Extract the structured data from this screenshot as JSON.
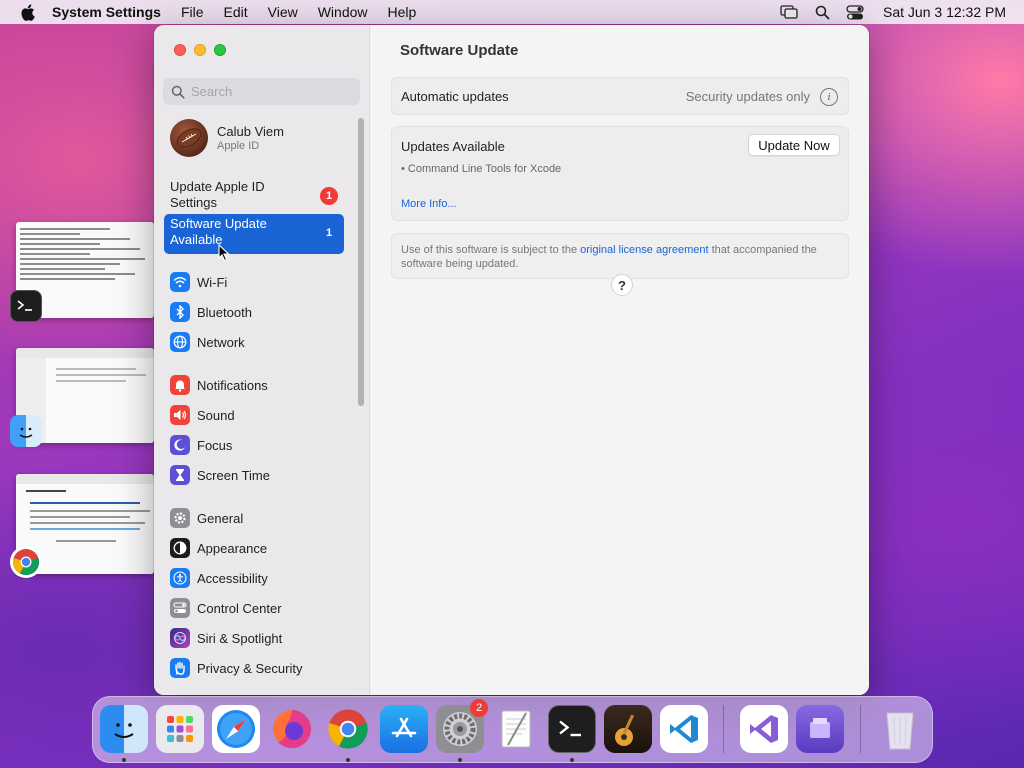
{
  "menubar": {
    "app_name": "System Settings",
    "items": [
      "File",
      "Edit",
      "View",
      "Window",
      "Help"
    ],
    "clock": "Sat Jun 3  12:32 PM"
  },
  "sidebar": {
    "search_placeholder": "Search",
    "account": {
      "name": "Calub Viem",
      "subtitle": "Apple ID"
    },
    "notices": [
      {
        "label": "Update Apple ID Settings",
        "badge": "1"
      },
      {
        "label": "Software Update Available",
        "badge": "1",
        "selected": true
      }
    ],
    "groups": [
      [
        {
          "label": "Wi-Fi",
          "icon": "wifi-icon",
          "color": "#1a7cf2"
        },
        {
          "label": "Bluetooth",
          "icon": "bluetooth-icon",
          "color": "#1a7cf2"
        },
        {
          "label": "Network",
          "icon": "globe-icon",
          "color": "#1a7cf2"
        }
      ],
      [
        {
          "label": "Notifications",
          "icon": "bell-icon",
          "color": "#f0443a"
        },
        {
          "label": "Sound",
          "icon": "speaker-icon",
          "color": "#f0443a"
        },
        {
          "label": "Focus",
          "icon": "moon-icon",
          "color": "#5b50d6"
        },
        {
          "label": "Screen Time",
          "icon": "hourglass-icon",
          "color": "#5b50d6"
        }
      ],
      [
        {
          "label": "General",
          "icon": "gear-icon",
          "color": "#8e8e93"
        },
        {
          "label": "Appearance",
          "icon": "appearance-icon",
          "color": "#1c1c1e"
        },
        {
          "label": "Accessibility",
          "icon": "accessibility-icon",
          "color": "#1a7cf2"
        },
        {
          "label": "Control Center",
          "icon": "control-center-icon",
          "color": "#8e8e93"
        },
        {
          "label": "Siri & Spotlight",
          "icon": "siri-icon",
          "color": "#7a3de0"
        },
        {
          "label": "Privacy & Security",
          "icon": "hand-icon",
          "color": "#1a7cf2"
        }
      ]
    ]
  },
  "content": {
    "title": "Software Update",
    "automatic_updates": {
      "label": "Automatic updates",
      "value": "Security updates only"
    },
    "updates": {
      "title": "Updates Available",
      "item": "• Command Line Tools for Xcode",
      "button": "Update Now",
      "more_info": "More Info..."
    },
    "license": {
      "prefix": "Use of this software is subject to the ",
      "link": "original license agreement",
      "suffix": " that accompanied the software being updated."
    },
    "help": "?"
  },
  "dock": {
    "apps": [
      "Finder",
      "Launchpad",
      "Safari",
      "Firefox",
      "Chrome",
      "App Store",
      "System Settings",
      "TextEdit",
      "Terminal",
      "GarageBand",
      "Visual Studio Code",
      "Visual Studio",
      "Xcode-like",
      "Trash"
    ],
    "settings_badge": "2"
  }
}
